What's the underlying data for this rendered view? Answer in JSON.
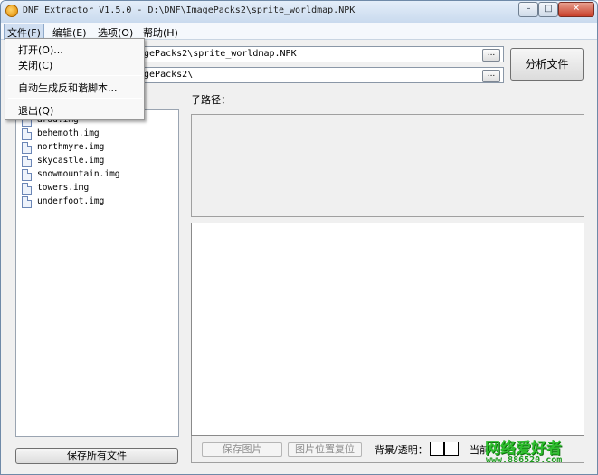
{
  "window": {
    "title": "DNF Extractor V1.5.0 - D:\\DNF\\ImagePacks2\\sprite_worldmap.NPK",
    "minimize_glyph": "–",
    "maximize_glyph": "□",
    "close_glyph": "✕"
  },
  "menubar": {
    "file": "文件(F)",
    "edit": "编辑(E)",
    "select": "选项(O)",
    "help": "帮助(H)"
  },
  "file_menu": {
    "open": "打开(O)...",
    "close": "关闭(C)",
    "auto_script": "自动生成反和谐脚本...",
    "exit": "退出(Q)"
  },
  "paths": {
    "npk_path": "agePacks2\\sprite_worldmap.NPK",
    "dir_path": "agePacks2\\",
    "browse_label": "..."
  },
  "analyze_button": "分析文件",
  "sub_path_label": "子路径：",
  "file_list": [
    "arad.img",
    "behemoth.img",
    "northmyre.img",
    "skycastle.img",
    "snowmountain.img",
    "towers.img",
    "underfoot.img"
  ],
  "save_all_button": "保存所有文件",
  "bottom_bar": {
    "save_image": "保存图片",
    "reset_position": "图片位置复位",
    "background_label": "背景/透明：",
    "current_label": "当前"
  },
  "watermark": {
    "title": "网络爱好者",
    "url": "www.886520.com"
  }
}
